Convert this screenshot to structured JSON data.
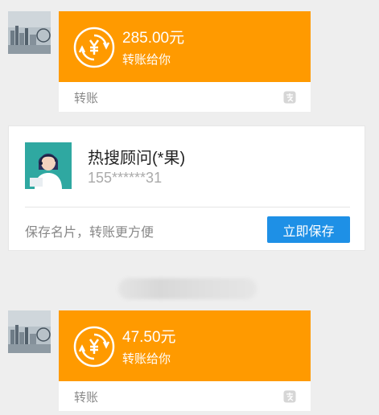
{
  "messages": [
    {
      "amount": "285.00元",
      "subtitle": "转账给你",
      "footer_label": "转账"
    },
    {
      "amount": "47.50元",
      "subtitle": "转账给你",
      "footer_label": "转账"
    }
  ],
  "namecard": {
    "name": "热搜顾问(*果)",
    "phone": "155******31",
    "hint": "保存名片，转账更方便",
    "save_button": "立即保存"
  },
  "icons": {
    "transfer": "yuan-transfer-icon",
    "footer": "alipay-icon",
    "sender": "avatar-city-skyline"
  },
  "colors": {
    "transfer_card": "#ff9a00",
    "save_button": "#1e90e6",
    "background": "#eeeeee"
  }
}
